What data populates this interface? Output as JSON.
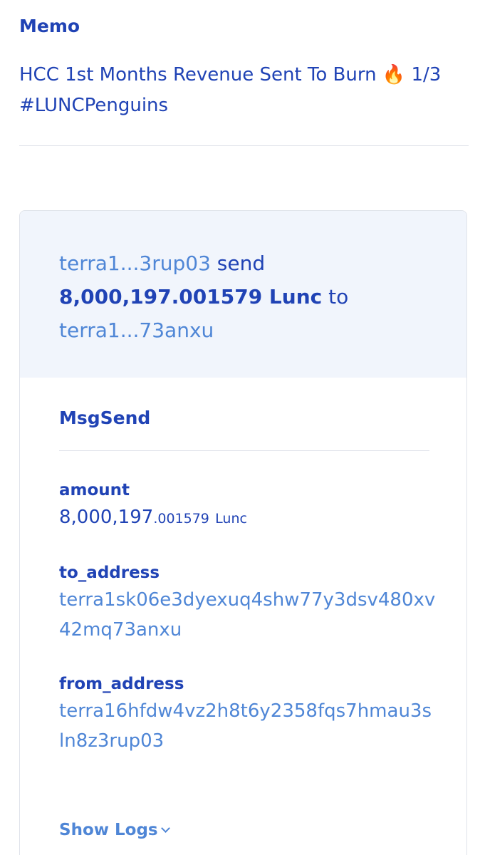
{
  "memo": {
    "title": "Memo",
    "text": "HCC 1st Months Revenue Sent To Burn 🔥 1/3 #LUNCPenguins"
  },
  "summary": {
    "from_short": "terra1...3rup03",
    "verb": "send",
    "amount": "8,000,197.001579 Lunc",
    "preposition": "to",
    "to_short": "terra1...73anxu"
  },
  "message": {
    "type": "MsgSend",
    "amount_label": "amount",
    "amount_integer": "8,000,197",
    "amount_decimal": ".001579",
    "amount_unit": "Lunc",
    "to_label": "to_address",
    "to_value": "terra1sk06e3dyexuq4shw77y3dsv480xv42mq73anxu",
    "from_label": "from_address",
    "from_value": "terra16hfdw4vz2h8t6y2358fqs7hmau3sln8z3rup03"
  },
  "show_logs_label": "Show Logs",
  "colors": {
    "primary": "#2043b5",
    "link": "#4f86d6",
    "summary_bg": "#f1f5fc",
    "divider": "#e0e3ea"
  }
}
